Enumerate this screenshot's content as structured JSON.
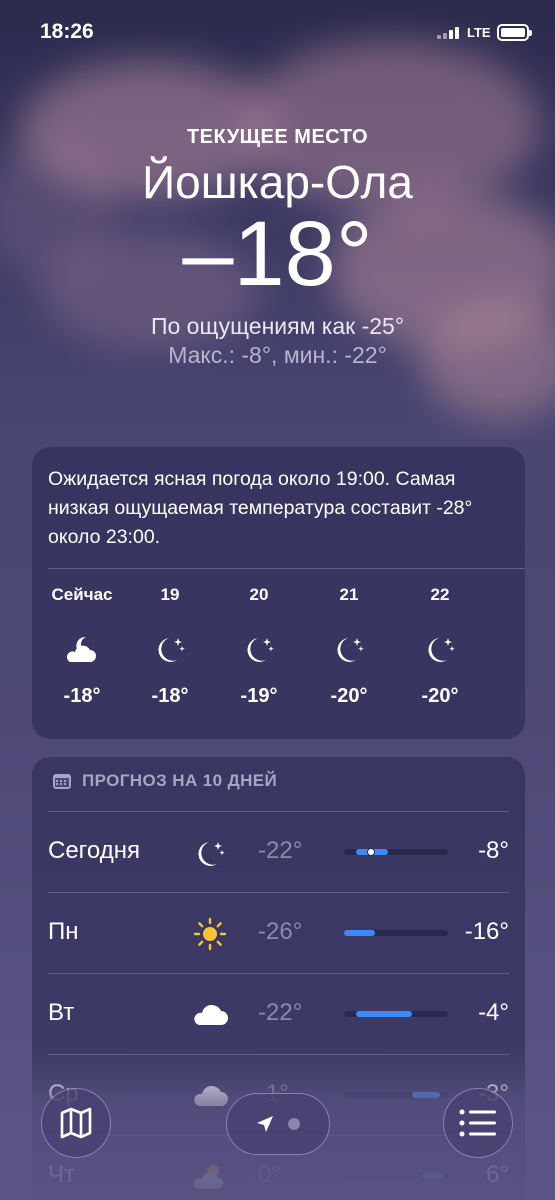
{
  "status_bar": {
    "time": "18:26",
    "network": "LTE"
  },
  "header": {
    "location_label": "ТЕКУЩЕЕ МЕСТО",
    "city": "Йошкар-Ола",
    "temperature": "–18°",
    "feels_like": "По ощущениям как -25°",
    "high_low": "Макс.: -8°, мин.: -22°"
  },
  "hourly": {
    "description": "Ожидается ясная погода около 19:00. Самая низкая ощущаемая температура составит -28° около 23:00.",
    "items": [
      {
        "label": "Сейчас",
        "icon": "partly-cloudy-night-icon",
        "temp": "-18°"
      },
      {
        "label": "19",
        "icon": "moon-stars-icon",
        "temp": "-18°"
      },
      {
        "label": "20",
        "icon": "moon-stars-icon",
        "temp": "-19°"
      },
      {
        "label": "21",
        "icon": "moon-stars-icon",
        "temp": "-20°"
      },
      {
        "label": "22",
        "icon": "moon-stars-icon",
        "temp": "-20°"
      }
    ]
  },
  "forecast": {
    "title": "ПРОГНОЗ НА 10 ДНЕЙ",
    "rows": [
      {
        "day": "Сегодня",
        "icon": "moon-stars-icon",
        "low": "-22°",
        "high": "-8°",
        "range_start": 0.12,
        "range_end": 0.42,
        "current": 0.26
      },
      {
        "day": "Пн",
        "icon": "sun-icon",
        "low": "-26°",
        "high": "-16°",
        "range_start": 0.0,
        "range_end": 0.3
      },
      {
        "day": "Вт",
        "icon": "cloud-icon",
        "low": "-22°",
        "high": "-4°",
        "range_start": 0.12,
        "range_end": 0.65
      },
      {
        "day": "Ср",
        "icon": "cloud-icon",
        "low": "-1°",
        "high": "-3°",
        "range_start": 0.65,
        "range_end": 0.92
      },
      {
        "day": "Чт",
        "icon": "partly-cloudy-icon",
        "low": "0°",
        "high": "6°",
        "range_start": 0.75,
        "range_end": 0.95
      }
    ]
  },
  "toolbar": {
    "map": "map-icon",
    "location": "location-arrow-icon",
    "list": "list-icon"
  },
  "colors": {
    "accent_bar": "#3d8af7",
    "background": "#4a4774"
  }
}
